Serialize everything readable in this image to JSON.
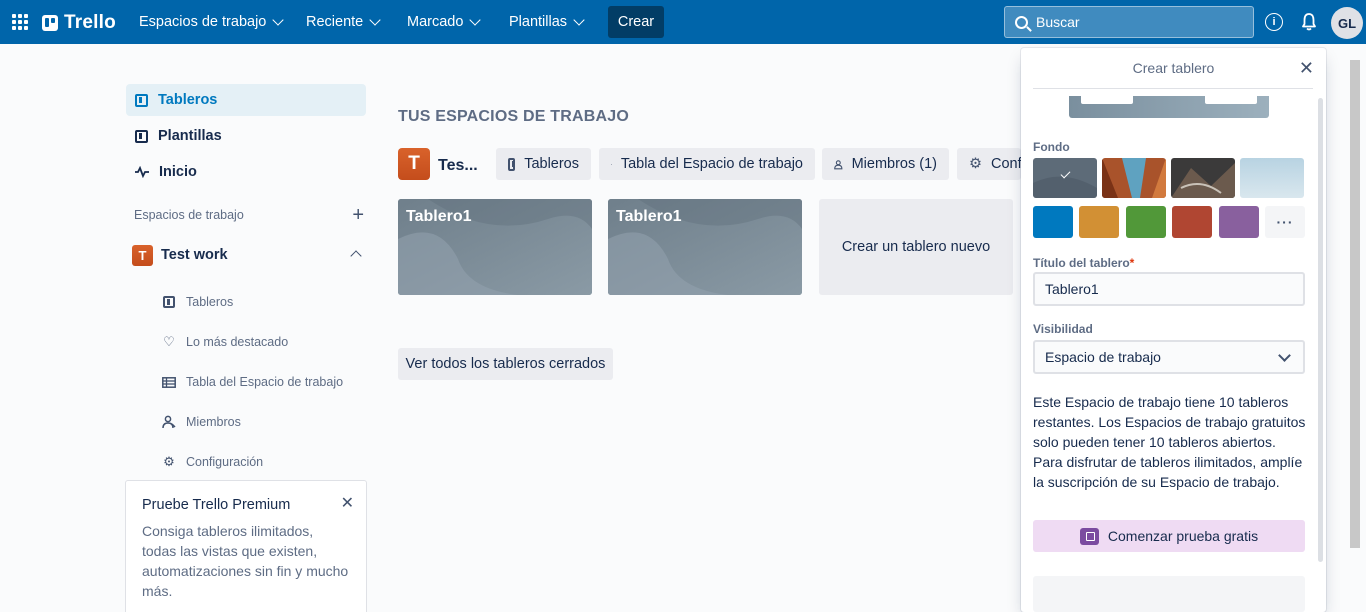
{
  "topbar": {
    "logo": "Trello",
    "nav": [
      {
        "label": "Espacios de trabajo"
      },
      {
        "label": "Reciente"
      },
      {
        "label": "Marcado"
      },
      {
        "label": "Plantillas"
      }
    ],
    "create_label": "Crear",
    "search_placeholder": "Buscar",
    "avatar_initials": "GL"
  },
  "sidebar": {
    "items": [
      {
        "label": "Tableros"
      },
      {
        "label": "Plantillas"
      },
      {
        "label": "Inicio"
      }
    ],
    "workspaces_header": "Espacios de trabajo",
    "workspace": {
      "initial": "T",
      "name": "Test work"
    },
    "sub_items": [
      {
        "label": "Tableros"
      },
      {
        "label": "Lo más destacado"
      },
      {
        "label": "Tabla del Espacio de trabajo"
      },
      {
        "label": "Miembros"
      },
      {
        "label": "Configuración"
      }
    ],
    "premium": {
      "title": "Pruebe Trello Premium",
      "text": "Consiga tableros ilimitados, todas las vistas que existen, automatizaciones sin fin y mucho más."
    }
  },
  "main": {
    "title": "TUS ESPACIOS DE TRABAJO",
    "workspace_initial": "T",
    "workspace_name": "Tes...",
    "pills": [
      {
        "label": "Tableros"
      },
      {
        "label": "Tabla del Espacio de trabajo"
      },
      {
        "label": "Miembros (1)"
      },
      {
        "label": "Confi"
      }
    ],
    "boards": [
      {
        "title": "Tablero1"
      },
      {
        "title": "Tablero1"
      }
    ],
    "new_board_label": "Crear un tablero nuevo",
    "closed_boards_label": "Ver todos los tableros cerrados"
  },
  "popover": {
    "title": "Crear tablero",
    "background_label": "Fondo",
    "background_colors": [
      "#0079bf",
      "#d29034",
      "#519839",
      "#b04632",
      "#89609e"
    ],
    "more_label": "···",
    "title_label": "Título del tablero",
    "required_mark": "*",
    "title_value": "Tablero1",
    "visibility_label": "Visibilidad",
    "visibility_value": "Espacio de trabajo",
    "info_text": "Este Espacio de trabajo tiene 10 tableros restantes. Los Espacios de trabajo gratuitos solo pueden tener 10 tableros abiertos. Para disfrutar de tableros ilimitados, amplíe la suscripción de su Espacio de trabajo.",
    "trial_label": "Comenzar prueba gratis"
  }
}
